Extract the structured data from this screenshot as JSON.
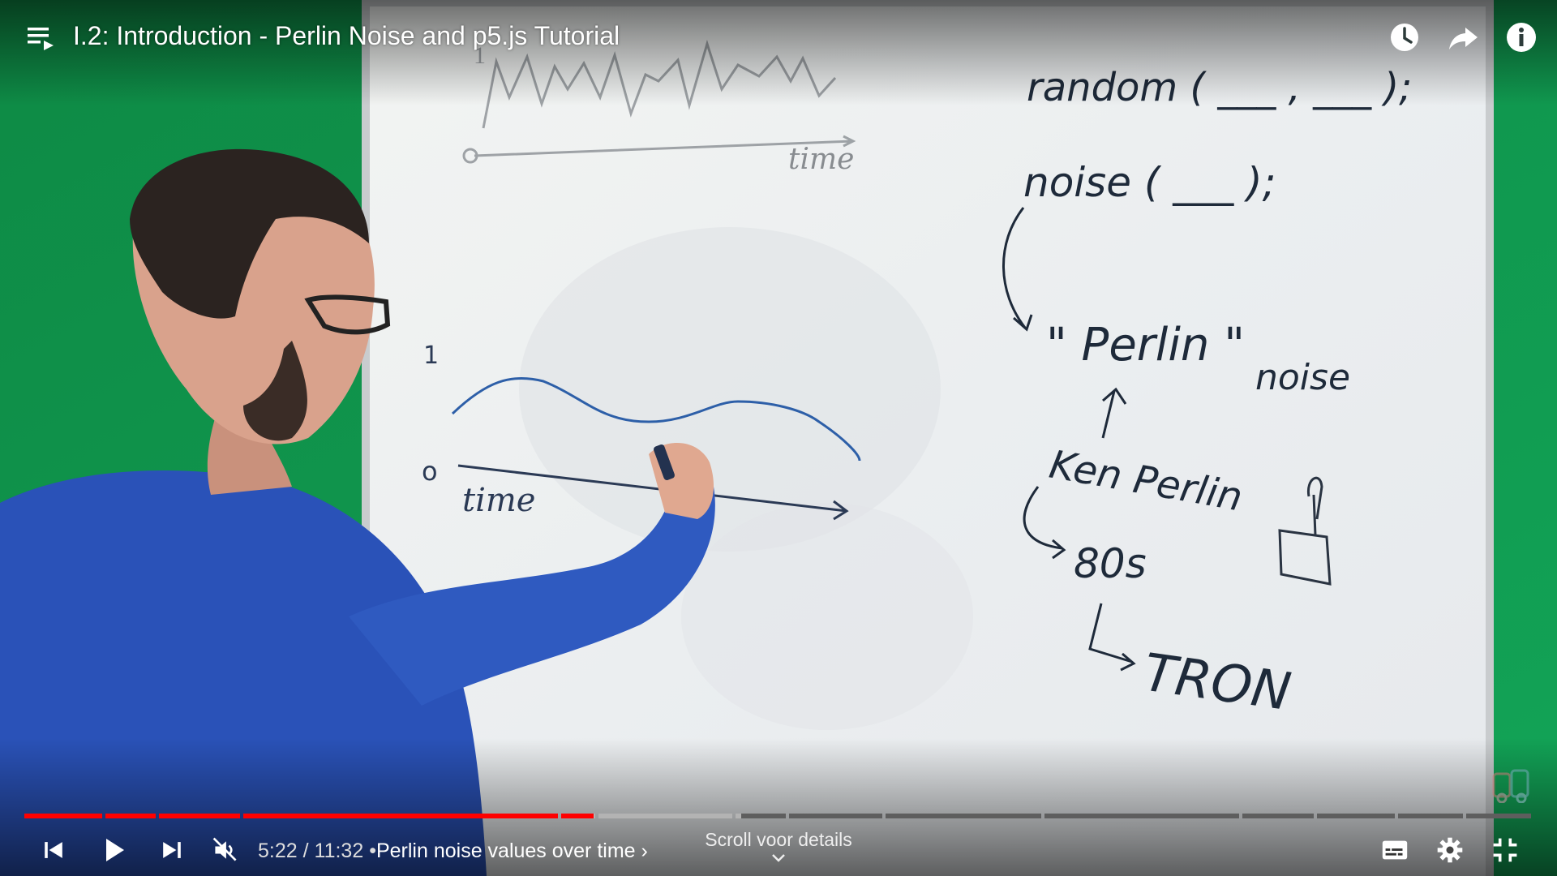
{
  "player": {
    "title": "I.2: Introduction - Perlin Noise and p5.js Tutorial",
    "time_current": "5:22",
    "time_separator": "/",
    "time_total": "11:32",
    "chapter_bullet": "•",
    "chapter_title": "Perlin noise values over time",
    "chapter_chevron": "›",
    "scroll_hint": "Scroll voor details",
    "progress": {
      "played_fraction": 0.378,
      "buffered_fraction": 0.476,
      "chapter_count": 14,
      "colors": {
        "played": "#ff0000",
        "buffered": "#b3b3b3",
        "unplayed": "#5e5e5e"
      }
    },
    "muted": true,
    "icons": {
      "playlist": "playlist-icon",
      "watch_later": "clock-icon",
      "share": "share-icon",
      "info": "info-icon",
      "previous": "skip-previous-icon",
      "play": "play-icon",
      "next": "skip-next-icon",
      "volume": "volume-muted-icon",
      "subtitles": "subtitles-icon",
      "settings": "gear-icon",
      "fullscreen_exit": "fullscreen-exit-icon"
    }
  },
  "whiteboard": {
    "top_graph": {
      "y_label": "1",
      "x_origin": "0",
      "x_axis": "time"
    },
    "bottom_graph": {
      "y_top": "1",
      "x_origin": "0",
      "x_axis": "time"
    },
    "notes": {
      "random_call": "random ( ___ , ___ );",
      "noise_call": "noise ( ___ );",
      "perlin": "\" Perlin \"",
      "noise_word": "noise",
      "ken_perlin": "Ken Perlin",
      "decade": "80s",
      "tron": "TRON"
    }
  }
}
